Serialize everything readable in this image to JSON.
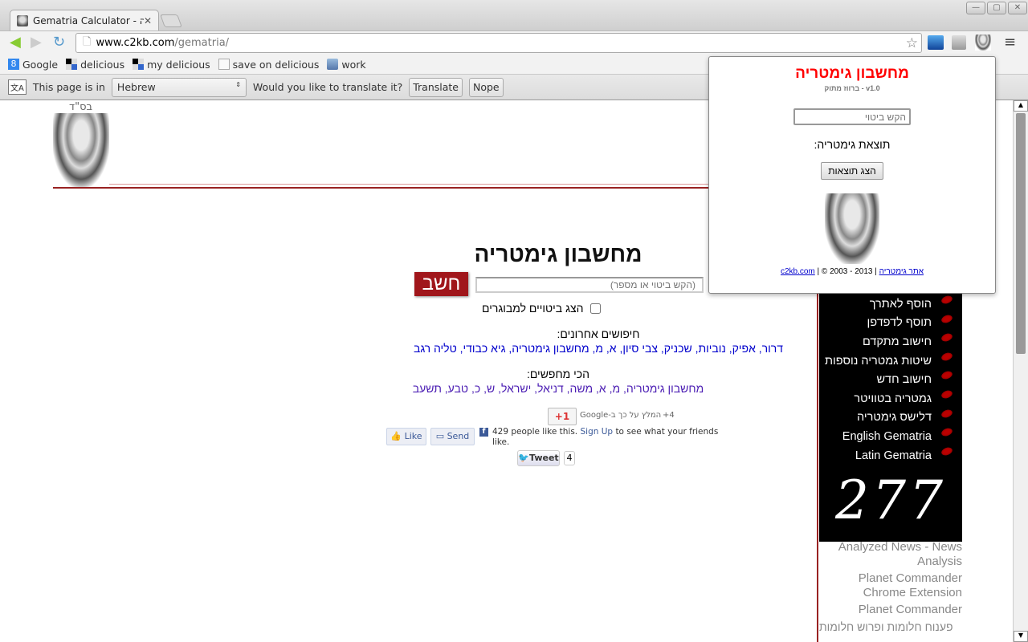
{
  "browser": {
    "tab_title": "Gematria Calculator - טריה",
    "url_domain": "www.c2kb.com",
    "url_path": "/gematria/",
    "bookmarks": [
      "Google",
      "delicious",
      "my delicious",
      "save on delicious",
      "work"
    ],
    "translate_bar": {
      "prefix": "This page is in",
      "language": "Hebrew",
      "question": "Would you like to translate it?",
      "translate_label": "Translate",
      "nope_label": "Nope"
    }
  },
  "page": {
    "bsd": "בס\"ד",
    "title": "מחשבון גימטריה",
    "search_placeholder": "(הקש ביטוי או מספר)",
    "calc_button": "חשב",
    "adult_checkbox_label": "הצג ביטויים למבוגרים",
    "recent_heading": "חיפושים אחרונים:",
    "recent_searches": "דרור, אפיק, נוביות, שכניק, צבי סיון, א, מ, מחשבון גימטריה, גיא כבודי, טליה רגב",
    "popular_heading": "הכי מחפשים:",
    "popular_searches": "מחשבון גימטריה, מ, א, משה, דניאל, ישראל, ש, כ, טבע, תשעב",
    "social": {
      "gplus_label": "+1",
      "gplus_text": "המלץ על כך ב-Google",
      "gplus_count": "+4",
      "like_label": "Like",
      "send_label": "Send",
      "fb_text": "429 people like this.",
      "fb_signup": "Sign Up",
      "fb_text2": "to see what your friends like.",
      "tweet_label": "Tweet",
      "tweet_count": "4"
    },
    "sidebar": {
      "items": [
        "הוסף לאתרך",
        "תוסף לדפדפן",
        "חישוב מתקדם",
        "שיטות גמטריה נוספות",
        "חישוב חדש",
        "גמטריה בטוויטר",
        "דלישס גימטריה",
        "English Gematria",
        "Latin Gematria"
      ],
      "logo_text": "277",
      "links": [
        "Analyzed News - News Analysis",
        "Planet Commander Chrome Extension",
        "Planet Commander",
        "פענוח חלומות ופרוש חלומות"
      ]
    }
  },
  "popup": {
    "title": "מחשבון גימטריה",
    "title_color": "#ff0000",
    "version": "v1.0 - ברווז מתוק",
    "input_placeholder": "הקש ביטוי",
    "result_label": "תוצאת גימטריה:",
    "show_button": "הצג תוצאות",
    "footer_link1": "c2kb.com",
    "footer_copy": "| © 2003 - 2013 |",
    "footer_link2": "אתר גימטריה"
  }
}
